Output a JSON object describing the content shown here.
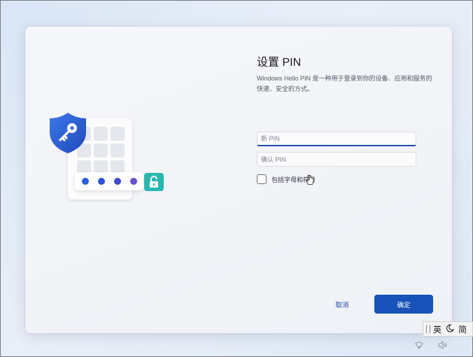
{
  "setup": {
    "title": "设置 PIN",
    "description": "Windows Hello PIN 是一种用于登录到你的设备、应用和服务的快速、安全的方式。"
  },
  "form": {
    "new_pin_placeholder": "新 PIN",
    "confirm_pin_placeholder": "确认 PIN",
    "include_letters_label": "包括字母和符号",
    "include_letters_checked": false
  },
  "actions": {
    "cancel_label": "取消",
    "ok_label": "确定"
  },
  "illustration": {
    "shield_color": "#2d63d6",
    "lock_color": "#29b7b0",
    "dot_colors": [
      "#2d5fd8",
      "#2f52d0",
      "#3d4ccc",
      "#6a4fcf"
    ]
  },
  "ime_toolbar": {
    "mode_label": "英",
    "width_icon": "moon-icon",
    "script_label": "简"
  },
  "tray": {
    "icons": [
      "network-icon",
      "volume-icon"
    ]
  },
  "colors": {
    "accent": "#1753b8",
    "link": "#1f4ea8"
  }
}
